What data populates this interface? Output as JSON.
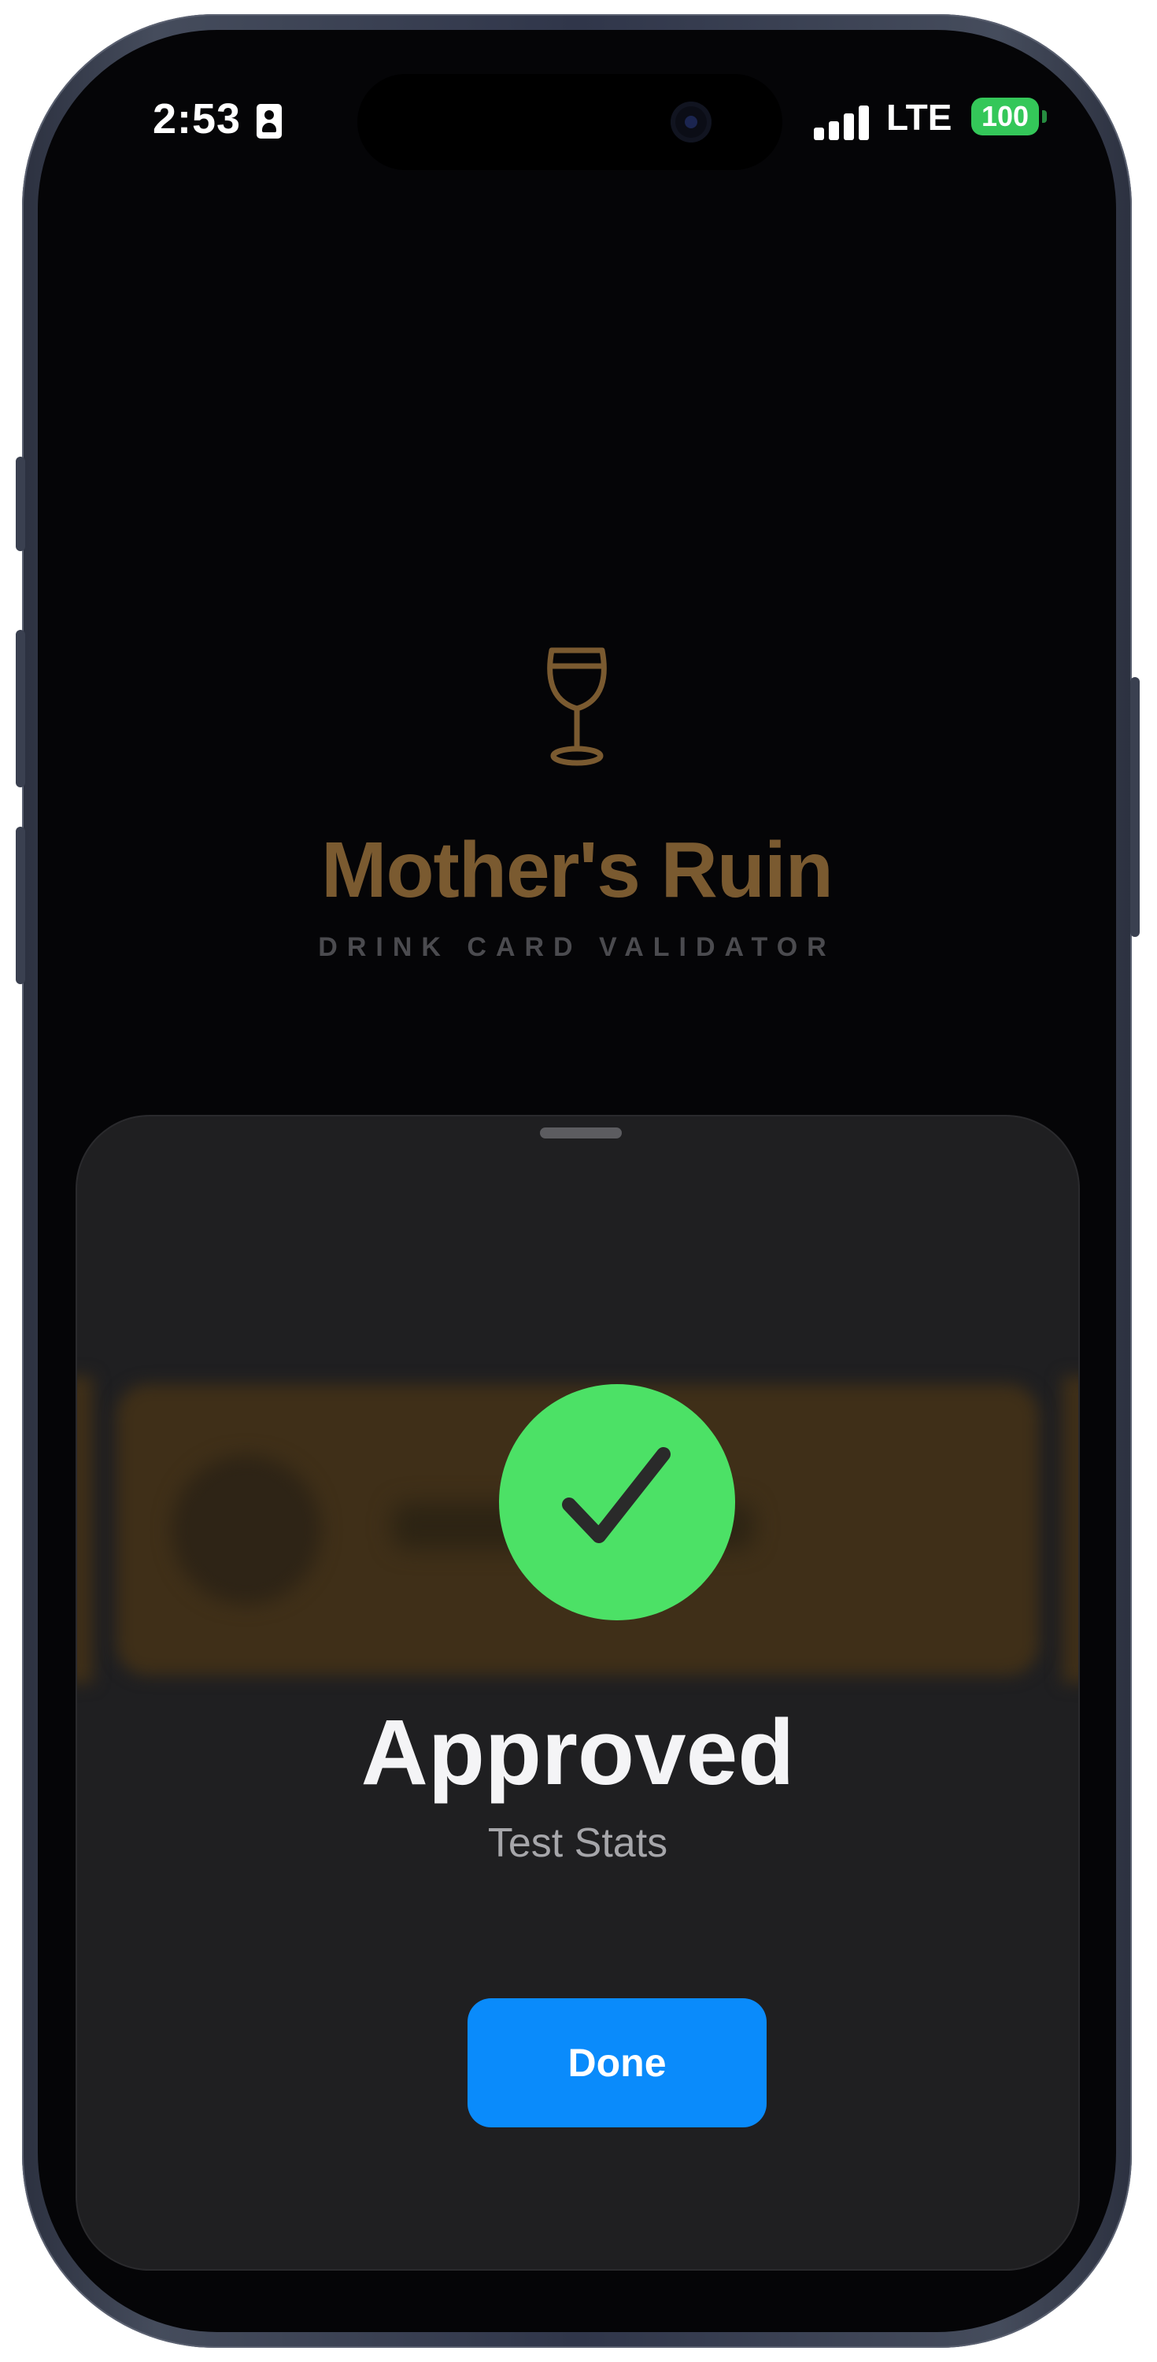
{
  "status_bar": {
    "time": "2:53",
    "network": "LTE",
    "battery": "100",
    "battery_color": "#34c759"
  },
  "header": {
    "icon": "wine-glass-icon",
    "title": "Mother's Ruin",
    "subtitle": "DRINK CARD VALIDATOR",
    "accent_color": "#7a5a30"
  },
  "result_sheet": {
    "status_icon": "checkmark-icon",
    "status_color": "#4ce166",
    "title": "Approved",
    "detail": "Test Stats",
    "done_label": "Done",
    "done_color": "#0a8bfb"
  }
}
